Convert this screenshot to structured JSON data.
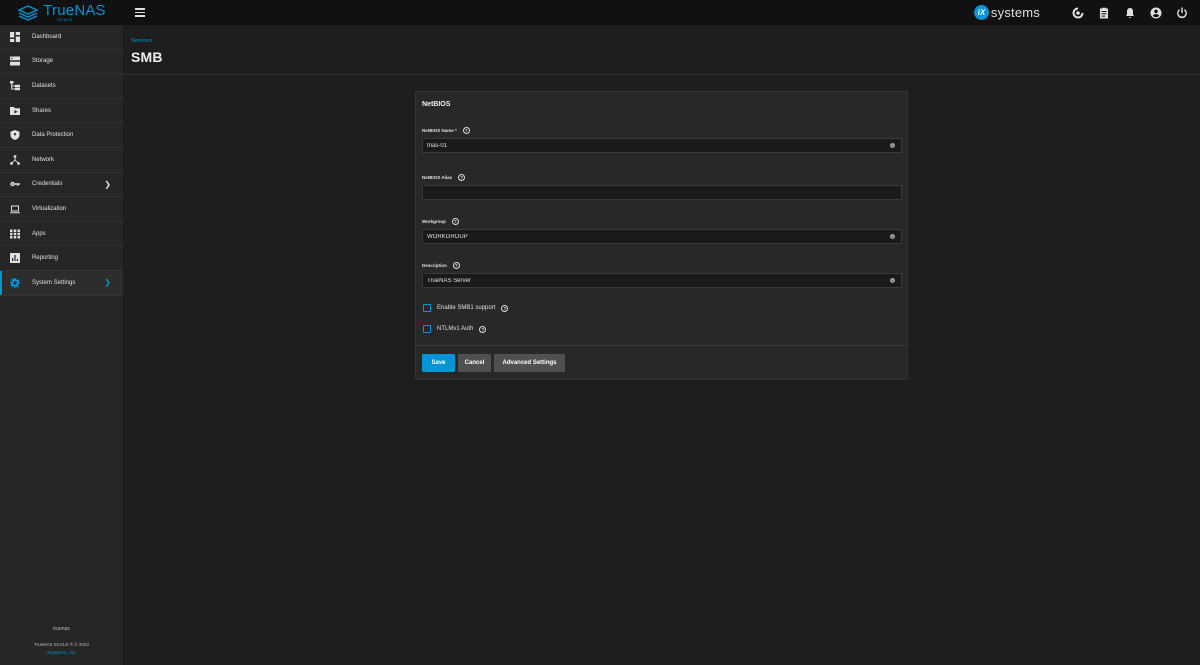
{
  "topbar": {
    "brand_name": "TrueNAS",
    "brand_sub": "SCALE",
    "vendor_mark": "iX",
    "vendor_name": "systems"
  },
  "sidebar": {
    "items": [
      {
        "label": "Dashboard",
        "icon": "dashboard-icon"
      },
      {
        "label": "Storage",
        "icon": "storage-icon"
      },
      {
        "label": "Datasets",
        "icon": "datasets-icon"
      },
      {
        "label": "Shares",
        "icon": "shares-icon"
      },
      {
        "label": "Data Protection",
        "icon": "shield-icon"
      },
      {
        "label": "Network",
        "icon": "network-icon"
      },
      {
        "label": "Credentials",
        "icon": "key-icon",
        "has_arrow": true
      },
      {
        "label": "Virtualization",
        "icon": "laptop-icon"
      },
      {
        "label": "Apps",
        "icon": "apps-icon"
      },
      {
        "label": "Reporting",
        "icon": "reporting-icon"
      },
      {
        "label": "System Settings",
        "icon": "gear-icon",
        "has_arrow": true,
        "active": true
      }
    ],
    "hostname": "truenas",
    "copyright": "TrueNAS SCALE ® © 2023",
    "company": "iXsystems, Inc."
  },
  "header": {
    "breadcrumb": "Services",
    "title": "SMB"
  },
  "form": {
    "section_title": "NetBIOS",
    "netbios_name_label": "NetBIOS Name *",
    "netbios_name_value": "tnas-01",
    "netbios_alias_label": "NetBIOS Alias",
    "netbios_alias_value": "",
    "workgroup_label": "Workgroup",
    "workgroup_value": "WORKGROUP",
    "description_label": "Description",
    "description_value": "TrueNAS Server",
    "smb1_label": "Enable SMB1 support",
    "ntlmv1_label": "NTLMv1 Auth",
    "help_glyph": "?",
    "clear_glyph": "×"
  },
  "buttons": {
    "save": "Save",
    "cancel": "Cancel",
    "advanced": "Advanced Settings"
  },
  "colors": {
    "accent": "#0095d5",
    "topbar": "#111111",
    "sidebar": "#262626",
    "background": "#1e1e1e",
    "card": "#282828"
  }
}
